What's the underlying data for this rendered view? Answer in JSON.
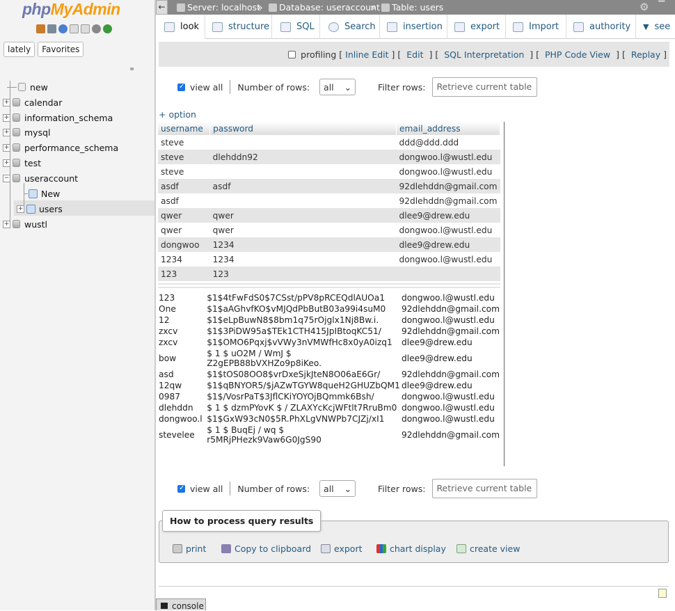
{
  "nav": {
    "logo_part1": "php",
    "logo_part2": "MyAdmin",
    "tabs": [
      "lately",
      "Favorites"
    ],
    "tree": [
      {
        "label": "new"
      },
      {
        "label": "calendar"
      },
      {
        "label": "information_schema"
      },
      {
        "label": "mysql"
      },
      {
        "label": "performance_schema"
      },
      {
        "label": "test"
      },
      {
        "label": "useraccount"
      },
      {
        "label": "New"
      },
      {
        "label": "users"
      },
      {
        "label": "wustl"
      }
    ]
  },
  "breadcrumb": {
    "server": "Server: localhost",
    "database": "Database: useraccount",
    "table": "Table: users",
    "separator": "»"
  },
  "tabs": [
    "look",
    "structure",
    "SQL",
    "Search",
    "insertion",
    "export",
    "Import",
    "authority",
    "see"
  ],
  "query_toolbar": {
    "profiling": "profiling",
    "links": [
      "Inline Edit",
      "Edit",
      "SQL Interpretation",
      "PHP Code View",
      "Replay"
    ]
  },
  "nav_controls": {
    "view_all": "view all",
    "rows_label": "Number of rows:",
    "rows_value": "all",
    "filter_label": "Filter rows:",
    "filter_placeholder": "Retrieve current table"
  },
  "option_link": "+ option",
  "table": {
    "columns": [
      "username",
      "password",
      "email_address"
    ],
    "rows_top": [
      [
        "steve",
        "",
        "ddd@ddd.ddd"
      ],
      [
        "steve",
        "dlehddn92",
        "dongwoo.l@wustl.edu"
      ],
      [
        "steve",
        "",
        "dongwoo.l@wustl.edu"
      ],
      [
        "asdf",
        "asdf",
        "92dlehddn@gmail.com"
      ],
      [
        "asdf",
        "",
        "92dlehddn@gmail.com"
      ],
      [
        "qwer",
        "qwer",
        "dlee9@drew.edu"
      ],
      [
        "qwer",
        "qwer",
        "dongwoo.l@wustl.edu"
      ],
      [
        "dongwoo",
        "1234",
        "dlee9@drew.edu"
      ],
      [
        "1234",
        "1234",
        "dongwoo.l@wustl.edu"
      ],
      [
        "123",
        "123",
        ""
      ]
    ],
    "rows_bottom": [
      [
        "123",
        "$1$4tFwFdS0$7CSst/pPV8pRCEQdlAUOa1",
        "dongwoo.l@wustl.edu"
      ],
      [
        "One",
        "$1$aAGhvfKO$vMJQdPbButB03a99i4suM0",
        "92dlehddn@gmail.com"
      ],
      [
        "12",
        "$1$eLpBuwN8$8bm1q75rOjglx1Nj8Bw.i.",
        "dongwoo.l@wustl.edu"
      ],
      [
        "zxcv",
        "$1$3PiDW95a$TEk1CTH415JpIBtoqKC51/",
        "92dlehddn@gmail.com"
      ],
      [
        "zxcv",
        "$1$OMO6Pqxj$vVWy3nVMWfHc8x0yA0izq1",
        "dlee9@drew.edu"
      ],
      [
        "bow",
        "$ 1 $ uO2M / WmJ $ Z2gEPB88bVXHZo9p8iKeo.",
        "dlee9@drew.edu"
      ],
      [
        "asd",
        "$1$tOS08OO8$vrDxeSjkJteN8O06aE6Gr/",
        "92dlehddn@gmail.com"
      ],
      [
        "12qw",
        "$1$qBNYOR5/$jAZwTGYW8queH2GHUZbQM1",
        "dlee9@drew.edu"
      ],
      [
        "0987",
        "$1$/VosrPaT$3JflCKiYOYOjBQmmk6Bsh/",
        "dongwoo.l@wustl.edu"
      ],
      [
        "dlehddn",
        "$ 1 $ dzmPYovK $ / ZLAXYcKcjWFtlt7RruBm0",
        "dongwoo.l@wustl.edu"
      ],
      [
        "dongwoo.l",
        "$1$GxW93cN0$5R.PhXLgVNWPb7CJZj/xI1",
        "dongwoo.l@wustl.edu"
      ],
      [
        "stevelee",
        "$ 1 $ BuqEj / wq $ r5MRjPHezk9Vaw6G0JgS90",
        "92dlehddn@gmail.com"
      ]
    ]
  },
  "ops": {
    "title": "How to process query results",
    "links": [
      "print",
      "Copy to clipboard",
      "export",
      "chart display",
      "create view"
    ]
  },
  "console_label": "console",
  "colors": {
    "link": "#235a81",
    "topbar": "#888888",
    "nav_bg": "#f3f3f3",
    "row_alt": "#e5e5e5"
  }
}
